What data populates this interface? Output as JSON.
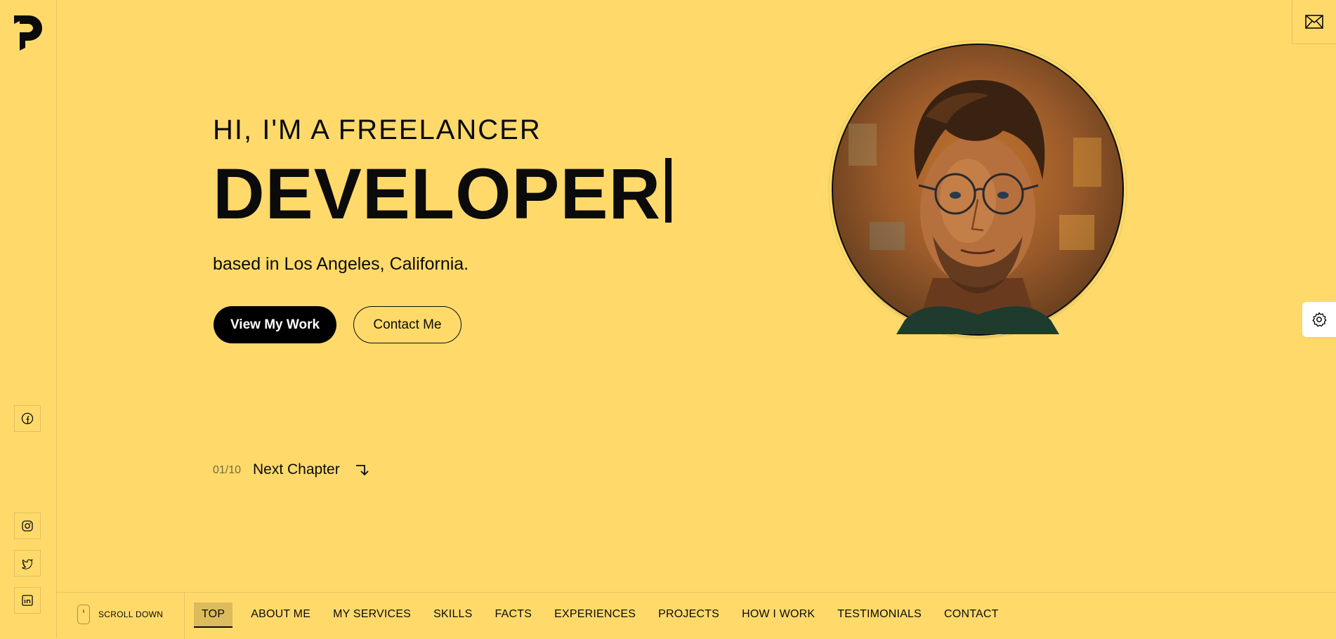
{
  "hero": {
    "subtitle": "HI, I'M A FREELANCER",
    "title": "DEVELOPER",
    "location": "based in Los Angeles, California.",
    "primary_button": "View My Work",
    "secondary_button": "Contact Me"
  },
  "chapter": {
    "counter": "01/10",
    "next_label": "Next Chapter"
  },
  "scroll_label": "SCROLL DOWN",
  "nav": {
    "items": [
      "TOP",
      "ABOUT ME",
      "MY SERVICES",
      "SKILLS",
      "FACTS",
      "EXPERIENCES",
      "PROJECTS",
      "HOW I WORK",
      "TESTIMONIALS",
      "CONTACT"
    ],
    "active": "TOP"
  },
  "social": [
    "facebook-icon",
    "instagram-icon",
    "twitter-icon",
    "linkedin-icon"
  ],
  "colors": {
    "background": "#FFDA6B",
    "text": "#0b0b0b",
    "button_primary": "#000000"
  }
}
